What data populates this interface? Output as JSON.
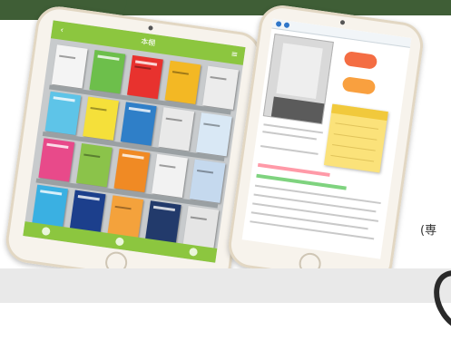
{
  "side_note": "(専",
  "bookshelf": {
    "header_title": "本棚",
    "header_left_icon": "back-icon",
    "header_right_icon": "menu-icon"
  },
  "colors": {
    "banner": "#3f5e36",
    "shelf_bar": "#8cc63f",
    "sticky_note": "#fbe27a"
  }
}
